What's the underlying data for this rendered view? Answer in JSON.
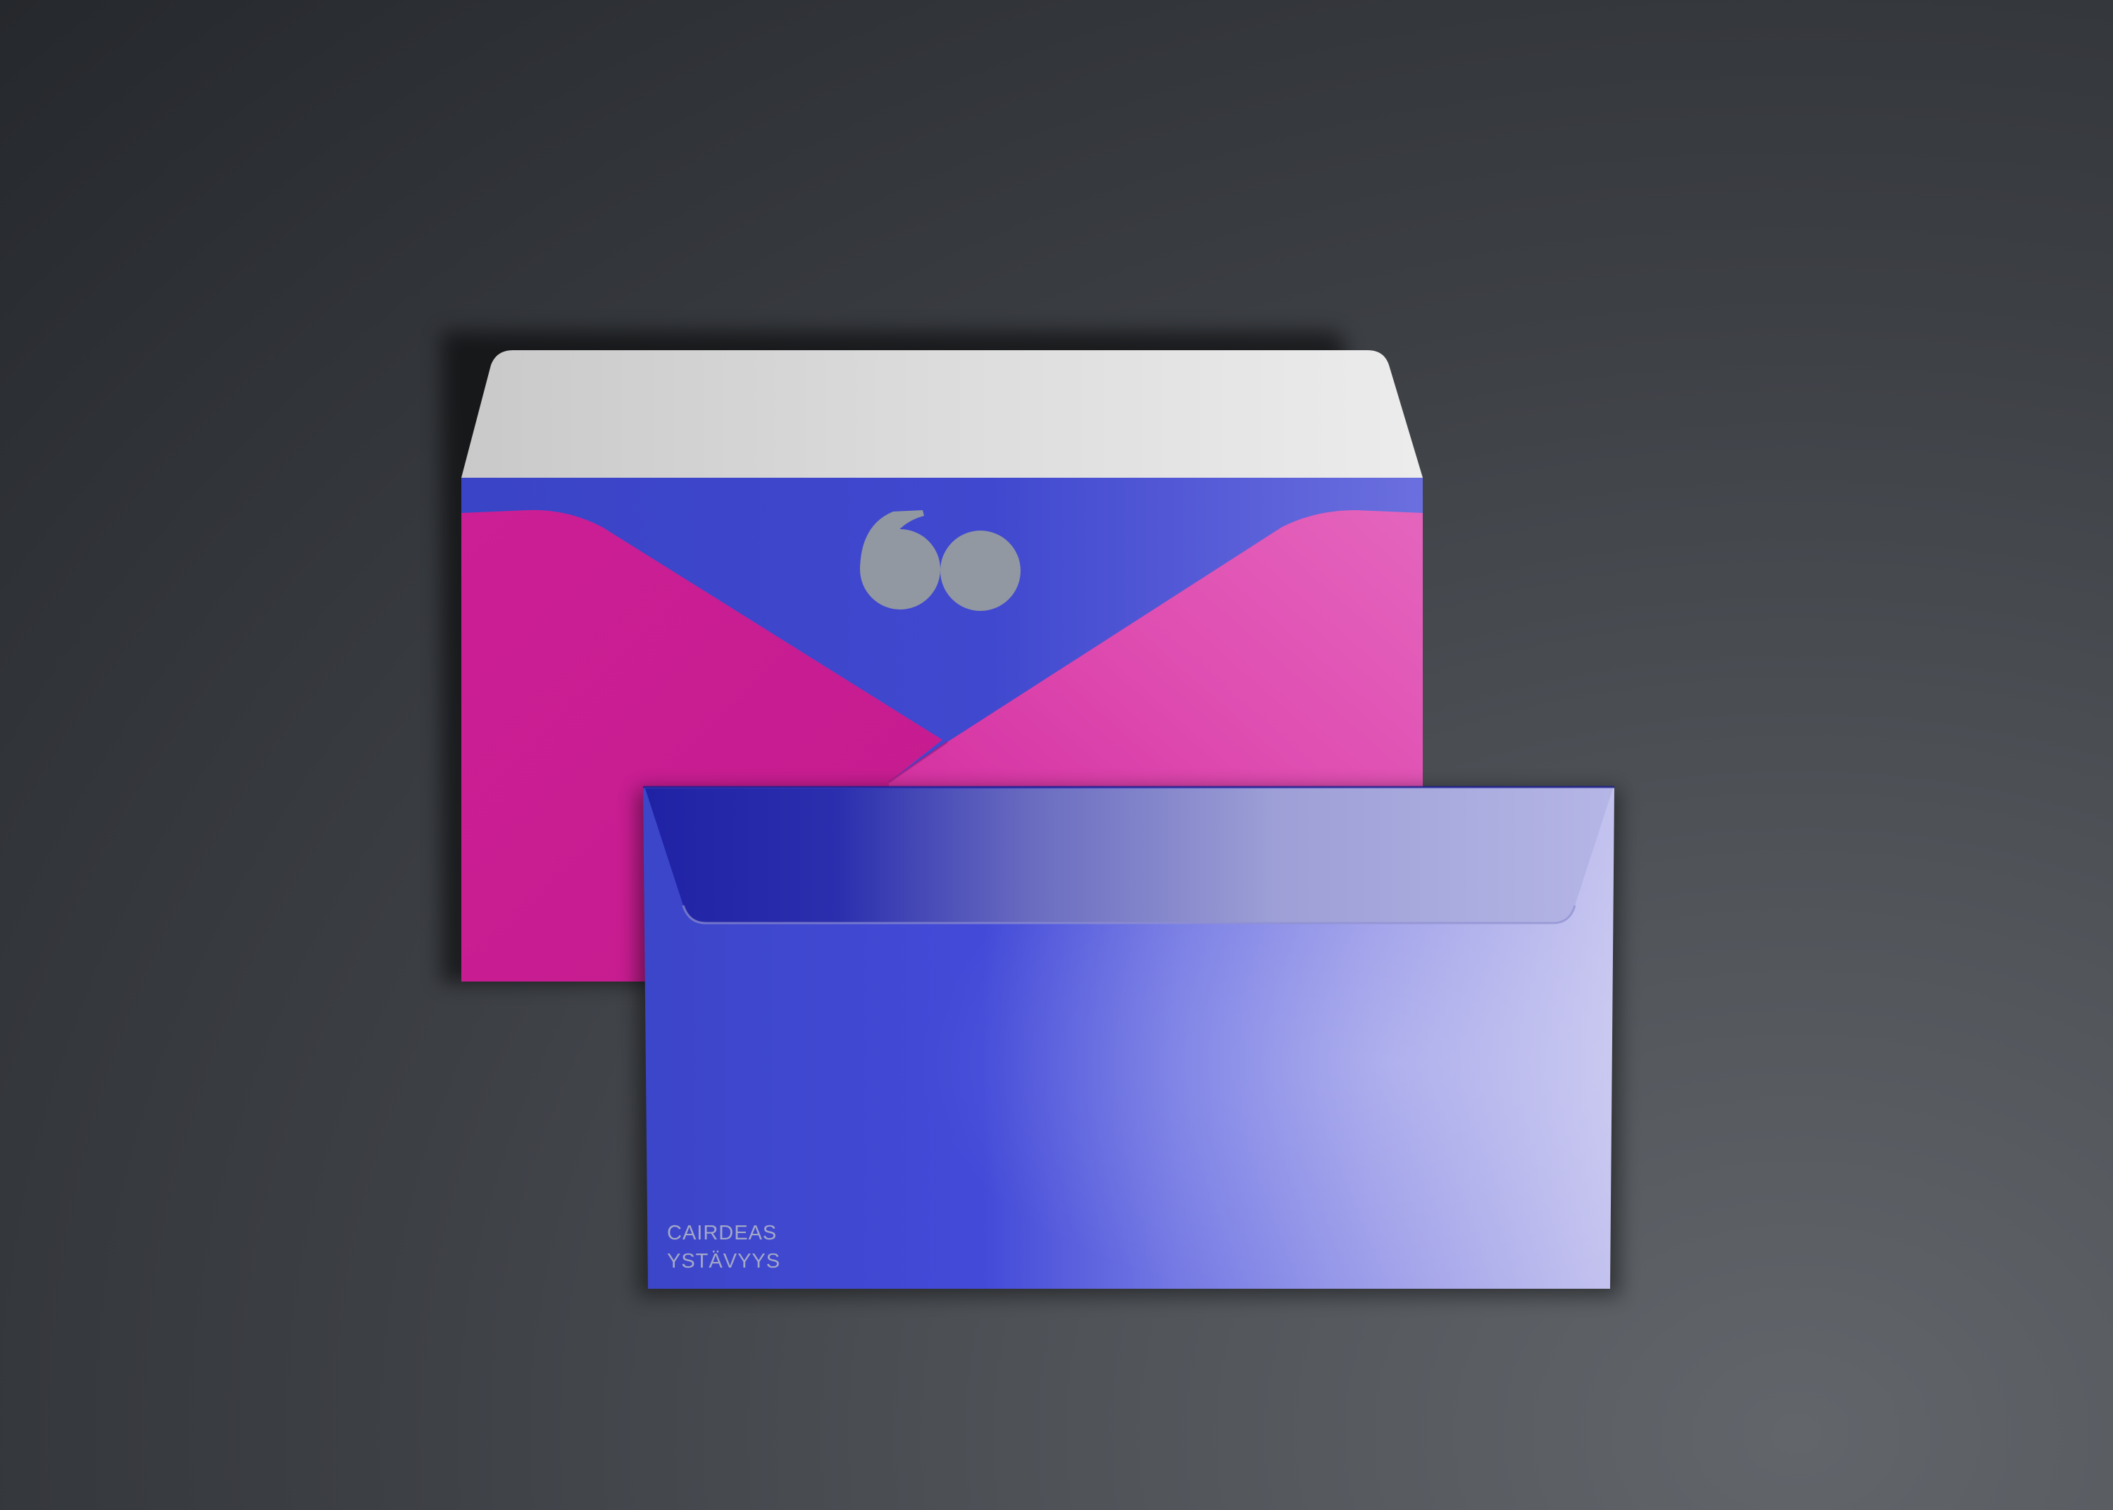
{
  "back_envelope": {
    "logo_icon": "sixty-mark",
    "colors": {
      "flap_light": "#e8e8e8",
      "band_blue": "#3f47cc",
      "pocket_magenta": "#c71f93",
      "logo_gray": "#9198a2"
    }
  },
  "front_envelope": {
    "line_1": "CAIRDEAS",
    "line_2": "YSTÄVYYS",
    "colors": {
      "body_blue": "#3f46d2",
      "body_light": "#b8b9ec",
      "text_gray": "#a3a8c7"
    }
  },
  "background_color": "#3d4045"
}
